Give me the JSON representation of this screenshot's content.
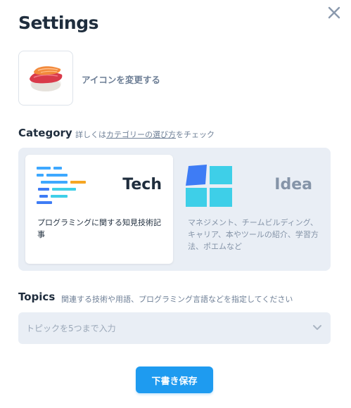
{
  "dialog": {
    "title": "Settings",
    "close_icon": "close-icon"
  },
  "emoji": {
    "icon": "sushi-emoji",
    "change_label": "アイコンを変更する"
  },
  "category": {
    "label": "Category",
    "hint_prefix": "詳しくは",
    "hint_link": "カテゴリーの選び方",
    "hint_suffix": "をチェック",
    "options": [
      {
        "name": "Tech",
        "icon": "tech-icon",
        "description": "プログラミングに関する知見技術記事",
        "selected": true,
        "color": "#1f2d3d"
      },
      {
        "name": "Idea",
        "icon": "idea-icon",
        "description": "マネジメント、チームビルディング、キャリア、本やツールの紹介、学習方法、ポエムなど",
        "selected": false,
        "color": "#8594a8"
      }
    ]
  },
  "topics": {
    "label": "Topics",
    "hint": "関連する技術や用語、プログラミング言語などを指定してください",
    "placeholder": "トピックを5つまで入力",
    "value": ""
  },
  "actions": {
    "save_label": "下書き保存"
  },
  "colors": {
    "accent": "#1e9bf0",
    "panel_bg": "#e9eef5",
    "muted_text": "#6e7f96"
  }
}
